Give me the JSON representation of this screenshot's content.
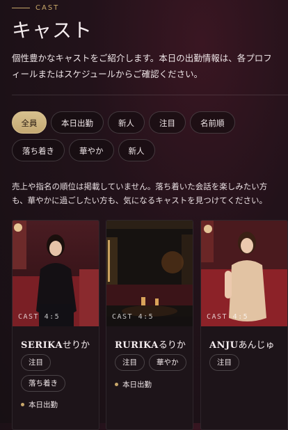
{
  "header": {
    "eyebrow": "CAST",
    "title": "キャスト",
    "lead": "個性豊かなキャストをご紹介します。本日の出勤情報は、各プロフィールまたはスケジュールからご確認ください。"
  },
  "filters": [
    {
      "label": "全員",
      "active": true
    },
    {
      "label": "本日出勤"
    },
    {
      "label": "新人"
    },
    {
      "label": "注目"
    },
    {
      "label": "名前順"
    },
    {
      "label": "落ち着き"
    },
    {
      "label": "華やか"
    },
    {
      "label": "新人"
    }
  ],
  "note": "売上や指名の順位は掲載していません。落ち着いた会話を楽しみたい方も、華やかに過ごしたい方も、気になるキャストを見つけてください。",
  "cards": [
    {
      "cast_label": "CAST 4:5",
      "name_en": "SERIKA",
      "name_jp": "せりか",
      "tags": [
        "注目",
        "落ち着き"
      ],
      "status": "本日出勤"
    },
    {
      "cast_label": "CAST 4:5",
      "name_en": "RURIKA",
      "name_jp": "るりか",
      "tags": [
        "注目",
        "華やか"
      ],
      "status": "本日出勤"
    },
    {
      "cast_label": "CAST 4:5",
      "name_en": "ANJU",
      "name_jp": "あんじゅ",
      "tags": [
        "注目"
      ],
      "status": ""
    }
  ],
  "colors": {
    "accent": "#c8a86a",
    "background": "#1a1116",
    "active_chip": "#d7c08e"
  }
}
